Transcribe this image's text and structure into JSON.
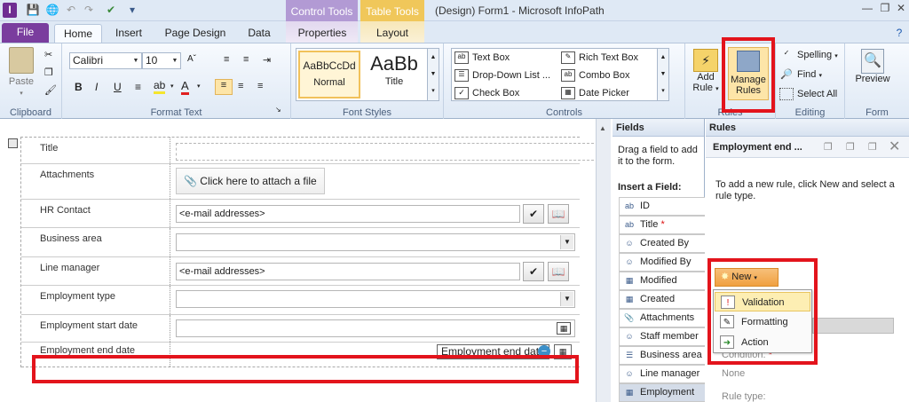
{
  "titlebar": {
    "title": "(Design) Form1  -  Microsoft InfoPath",
    "app_icon": "I",
    "context_tabs": {
      "control_tools": "Control Tools",
      "table_tools": "Table Tools"
    }
  },
  "tabs": [
    "File",
    "Home",
    "Insert",
    "Page Design",
    "Data",
    "Properties",
    "Layout"
  ],
  "ribbon": {
    "clipboard": {
      "paste": "Paste",
      "label": "Clipboard"
    },
    "format_text": {
      "font": "Calibri",
      "size": "10",
      "label": "Format Text"
    },
    "font_styles": {
      "normal_sample": "AaBbCcDd",
      "normal": "Normal",
      "title_sample": "AaBb",
      "title": "Title",
      "label": "Font Styles"
    },
    "controls": {
      "items": [
        "Text Box",
        "Rich Text Box",
        "Drop-Down List ...",
        "Combo Box",
        "Check Box",
        "Date Picker"
      ],
      "label": "Controls"
    },
    "rules": {
      "add_rule": "Add Rule",
      "manage_rules": "Manage Rules",
      "label": "Rules"
    },
    "editing": {
      "spelling": "Spelling",
      "find": "Find",
      "select_all": "Select All",
      "label": "Editing"
    },
    "form": {
      "preview": "Preview",
      "label": "Form"
    }
  },
  "form": {
    "rows": [
      {
        "label": "Title"
      },
      {
        "label": "Attachments",
        "attach_text": "Click here to attach a file"
      },
      {
        "label": "HR Contact",
        "value": "<e-mail addresses>"
      },
      {
        "label": "Business area"
      },
      {
        "label": "Line manager",
        "value": "<e-mail addresses>"
      },
      {
        "label": "Employment type"
      },
      {
        "label": "Employment start date"
      },
      {
        "label": "Employment end date",
        "chip": "Employment end date"
      }
    ]
  },
  "fields_pane": {
    "title": "Fields",
    "hint": "Drag a field to add it to the form.",
    "insert_label": "Insert a Field:",
    "items": [
      "ID",
      "Title",
      "Created By",
      "Modified By",
      "Modified",
      "Created",
      "Attachments",
      "Staff member",
      "Business area",
      "Line manager",
      "Employment"
    ]
  },
  "rules_pane": {
    "title": "Rules",
    "subtitle": "Employment end ...",
    "hint": "To add a new rule, click New and select a rule type.",
    "new_button": "New",
    "menu": [
      "Validation",
      "Formatting",
      "Action"
    ],
    "condition_label": "Condition:",
    "condition_value": "None",
    "rule_type_label": "Rule type:"
  },
  "colors": {
    "file_tab": "#7a3d9e",
    "control_tools": "#b29ad4",
    "table_tools": "#f0c75a",
    "highlight": "#e3141c",
    "new_button": "#f0a040"
  }
}
